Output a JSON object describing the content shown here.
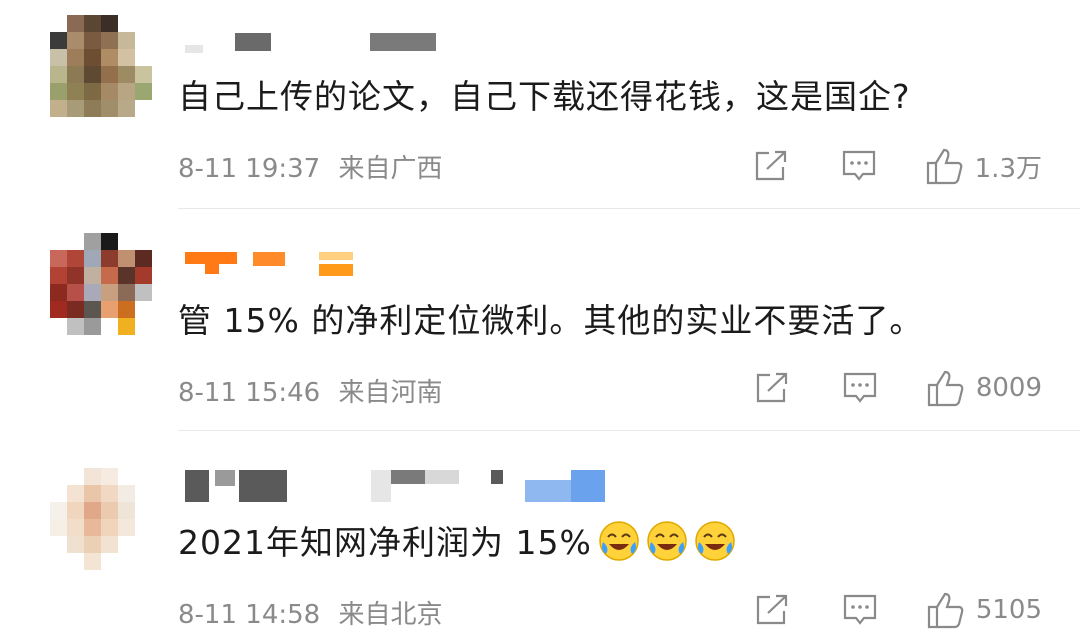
{
  "comments": [
    {
      "text": "自己上传的论文，自己下载还得花钱，这是国企?",
      "time": "8-11 19:37",
      "location": "来自广西",
      "likes": "1.3万",
      "avatar_colors": [
        "#ffffff",
        "#8a6a55",
        "#5b4634",
        "#3a2e27",
        "#ffffff",
        "#ffffff",
        "#3b3b3b",
        "#a98c6a",
        "#7a5a40",
        "#8e7153",
        "#c8b89a",
        "#ffffff",
        "#c9c0a8",
        "#9e7e5a",
        "#6d4e33",
        "#b08c65",
        "#d2c2a3",
        "#ffffff",
        "#b9b68e",
        "#8c7a54",
        "#5e4a32",
        "#946f4b",
        "#9c8b63",
        "#c9c39e",
        "#9aa06c",
        "#8f8154",
        "#7d6a45",
        "#a68a65",
        "#b7a584",
        "#9aa770",
        "#c2b08c",
        "#a89b77",
        "#8e7c58",
        "#a08e6a",
        "#b8aa88",
        "#ffffff"
      ],
      "name_color": "#666666",
      "emojis": 0
    },
    {
      "text": "管 15% 的净利定位微利。其他的实业不要活了。",
      "time": "8-11 15:46",
      "location": "来自河南",
      "likes": "8009",
      "avatar_colors": [
        "#ffffff",
        "#ffffff",
        "#a0a0a0",
        "#1a1a1a",
        "#ffffff",
        "#ffffff",
        "#c8685a",
        "#b04638",
        "#a0a8b8",
        "#8c3b2c",
        "#c09070",
        "#5c2a20",
        "#b24334",
        "#903328",
        "#c0b0a0",
        "#c56a4a",
        "#5a3428",
        "#a43a2c",
        "#8c2a20",
        "#b8504a",
        "#a9a9b9",
        "#c7a080",
        "#8b6a58",
        "#c0c0c0",
        "#a02a20",
        "#7a2a20",
        "#5c5650",
        "#e8a070",
        "#cc6e20",
        "#ffffff",
        "#ffffff",
        "#c0c0c0",
        "#9a9a9a",
        "#ffffff",
        "#f0b020",
        "#ffffff"
      ],
      "name_color": "#ff8a1e",
      "emojis": 0
    },
    {
      "text": "2021年知网净利润为 15%",
      "time": "8-11 14:58",
      "location": "来自北京",
      "likes": "5105",
      "avatar_colors": [
        "#ffffff",
        "#ffffff",
        "#f2e4d6",
        "#f6ebe0",
        "#ffffff",
        "#ffffff",
        "#ffffff",
        "#f4e2d2",
        "#eac6a8",
        "#f0d8c2",
        "#f2ece4",
        "#ffffff",
        "#f6f0ea",
        "#f0d6bc",
        "#e0a888",
        "#eccab0",
        "#efe4d8",
        "#ffffff",
        "#f6efe6",
        "#f2ddc8",
        "#e8b89a",
        "#f0d4bc",
        "#f4e8dc",
        "#ffffff",
        "#ffffff",
        "#f0e0d0",
        "#ecd0b6",
        "#f2e2d2",
        "#ffffff",
        "#ffffff",
        "#ffffff",
        "#ffffff",
        "#f4e4d4",
        "#ffffff",
        "#ffffff",
        "#ffffff"
      ],
      "name_color": "#555555",
      "emojis": 3
    }
  ],
  "icons": {
    "share": "share-icon",
    "comment": "comment-icon",
    "like": "thumbs-up-icon",
    "emoji": "laugh-cry-emoji-icon"
  }
}
